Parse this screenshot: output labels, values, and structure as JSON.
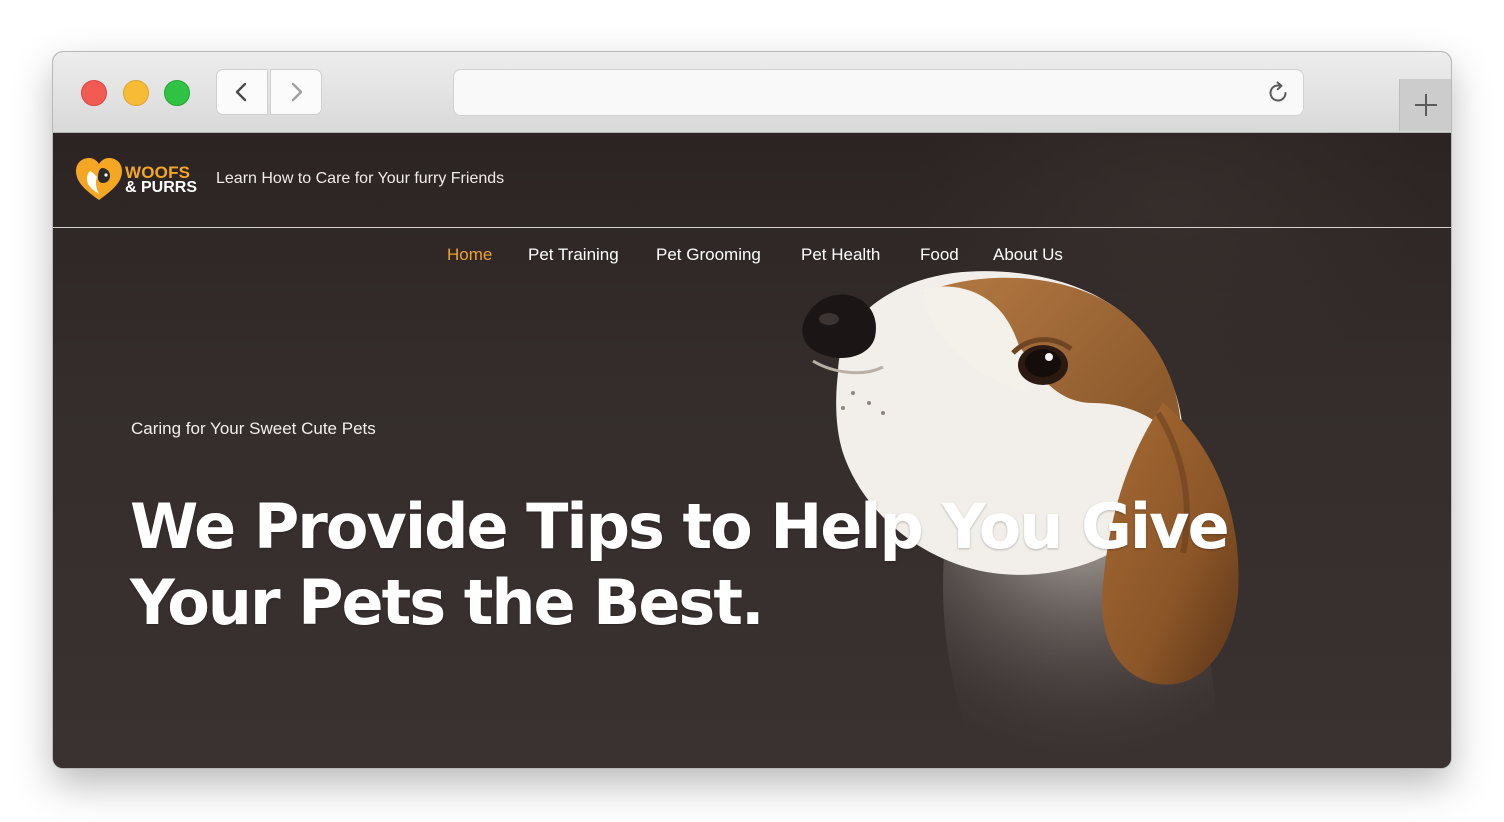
{
  "browser": {
    "back_icon": "chevron-left-icon",
    "forward_icon": "chevron-right-icon",
    "reload_icon": "reload-icon",
    "new_tab_icon": "plus-icon",
    "address_value": ""
  },
  "site": {
    "logo_line1": "WOOFS",
    "logo_line2": "& PURRS",
    "tagline": "Learn How to Care for Your furry Friends",
    "brand_color": "#f5a623"
  },
  "nav": {
    "items": [
      {
        "label": "Home",
        "active": true
      },
      {
        "label": "Pet Training",
        "active": false
      },
      {
        "label": "Pet Grooming",
        "active": false
      },
      {
        "label": "Pet Health",
        "active": false
      },
      {
        "label": "Food",
        "active": false
      },
      {
        "label": "About Us",
        "active": false
      }
    ]
  },
  "hero": {
    "subtitle": "Caring for Your Sweet Cute Pets",
    "title": "We Provide Tips to Help You Give Your Pets the Best."
  }
}
